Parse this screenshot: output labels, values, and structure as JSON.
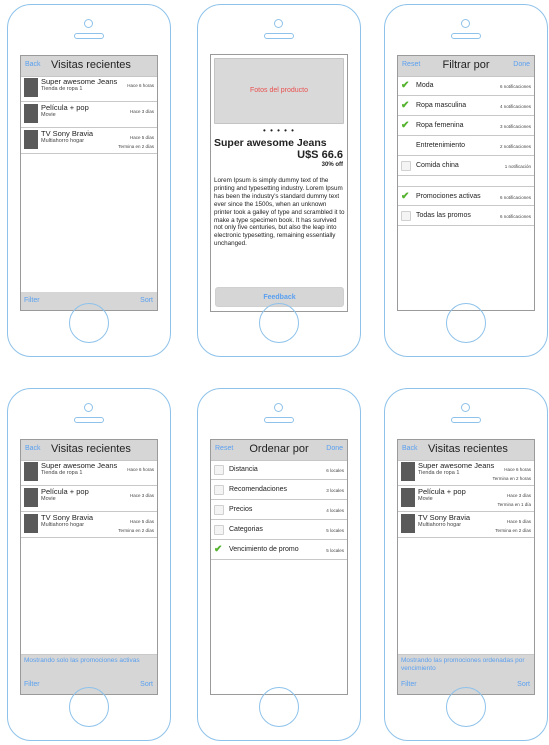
{
  "visits": {
    "title": "Visitas recientes",
    "back": "Back",
    "filter": "Filter",
    "sort": "Sort",
    "items": [
      {
        "name": "Super awesome Jeans",
        "store": "Tienda de ropa 1",
        "time": "Hace 6 horas"
      },
      {
        "name": "Película + pop",
        "store": "Movie",
        "time": "Hace 3 días"
      },
      {
        "name": "TV Sony Bravia",
        "store": "Multiahorro hogar",
        "time": "Hace 5 días",
        "ends": "Termina en 2 días"
      }
    ]
  },
  "product": {
    "photos": "Fotos del producto",
    "dots": "• • • • •",
    "name": "Super awesome Jeans",
    "price": "U$S 66.6",
    "discount": "30% off",
    "description": "Lorem Ipsum is simply dummy text of the printing and typesetting industry. Lorem Ipsum has been the industry's standard dummy text ever since the 1500s, when an unknown printer took a galley of type and scrambled it to make a type specimen book. It has survived not only five centuries, but also the leap into electronic typesetting, remaining essentially unchanged.",
    "feedback": "Feedback"
  },
  "filter": {
    "reset": "Reset",
    "title": "Filtrar por",
    "done": "Done",
    "items": [
      {
        "label": "Moda",
        "count": "6 notificaciones",
        "checked": true
      },
      {
        "label": "Ropa masculina",
        "count": "4 notificaciones",
        "checked": true
      },
      {
        "label": "Ropa femenina",
        "count": "3 notificaciones",
        "checked": true
      },
      {
        "label": "Entretenimiento",
        "count": "2 notificaciones",
        "checked": false
      },
      {
        "label": "Comida china",
        "count": "1 notificación",
        "checked": false
      }
    ],
    "items2": [
      {
        "label": "Promociones activas",
        "count": "6 notificaciones",
        "checked": true
      },
      {
        "label": "Todas las promos",
        "count": "6 notificaciones",
        "checked": false
      }
    ]
  },
  "visits_active": {
    "title": "Visitas recientes",
    "back": "Back",
    "filter": "Filter",
    "sort": "Sort",
    "info": "Mostrando solo las promociones activas",
    "items": [
      {
        "name": "Super awesome Jeans",
        "store": "Tienda de ropa 1",
        "time": "Hace 6 horas"
      },
      {
        "name": "Película + pop",
        "store": "Movie",
        "time": "Hace 3 días"
      },
      {
        "name": "TV Sony Bravia",
        "store": "Multiahorro hogar",
        "time": "Hace 5 días",
        "ends": "Termina en 2 días"
      }
    ]
  },
  "sort": {
    "reset": "Reset",
    "title": "Ordenar por",
    "done": "Done",
    "items": [
      {
        "label": "Distancia",
        "count": "6 locales",
        "checked": false
      },
      {
        "label": "Recomendaciones",
        "count": "3 locales",
        "checked": false
      },
      {
        "label": "Precios",
        "count": "4 locales",
        "checked": false
      },
      {
        "label": "Categorias",
        "count": "5 locales",
        "checked": false
      },
      {
        "label": "Vencimiento de promo",
        "count": "5 locales",
        "checked": true
      }
    ]
  },
  "visits_sorted": {
    "title": "Visitas recientes",
    "back": "Back",
    "filter": "Filter",
    "sort": "Sort",
    "info": "Mostrando las promociones ordenadas por vencimiento",
    "items": [
      {
        "name": "Super awesome Jeans",
        "store": "Tienda de ropa 1",
        "time": "Hace 6 horas",
        "ends": "Termina en 2 horas"
      },
      {
        "name": "Película + pop",
        "store": "Movie",
        "time": "Hace 3 días",
        "ends": "Termina en 1 día"
      },
      {
        "name": "TV Sony Bravia",
        "store": "Multiahorro hogar",
        "time": "Hace 5 días",
        "ends": "Termina en 2 días"
      }
    ]
  },
  "colors": {
    "accent": "#5aa0f0",
    "check": "#55b330",
    "frame": "#8ec2ea",
    "bar": "#d6d6d6",
    "thumb": "#5a5a5a",
    "photos_text": "#e8514f"
  },
  "icons": [
    "check-icon",
    "checkbox-icon",
    "home-button-icon",
    "camera-icon"
  ]
}
